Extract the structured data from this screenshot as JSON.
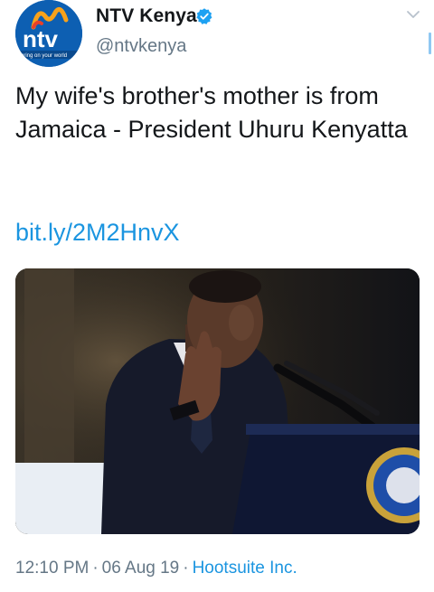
{
  "account": {
    "display_name": "NTV Kenya",
    "handle": "@ntvkenya",
    "verified": true,
    "avatar_logo_text": "ntv",
    "avatar_tagline": "bring on your world"
  },
  "tweet": {
    "text": "My wife's brother's mother is from Jamaica - President Uhuru Kenyatta",
    "link": "bit.ly/2M2HnvX",
    "media_description": "Photo of a speaker at a podium"
  },
  "meta": {
    "time": "12:10 PM",
    "separator": "·",
    "date": "06 Aug 19",
    "source": "Hootsuite Inc."
  },
  "icons": {
    "verified": "verified-badge-icon",
    "menu": "chevron-down-icon"
  },
  "colors": {
    "link": "#1b95e0",
    "verified": "#1da1f2",
    "secondary_text": "#657786",
    "avatar_bg": "#0d5fb2"
  }
}
